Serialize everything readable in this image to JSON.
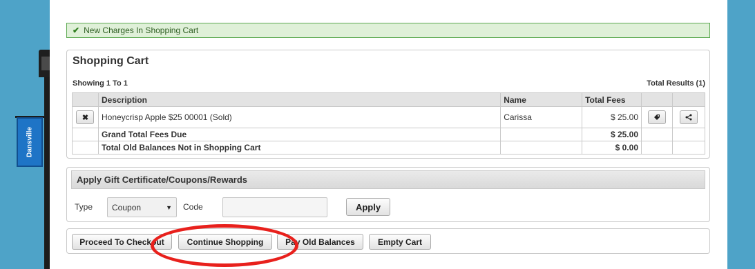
{
  "alert": {
    "text": "New Charges In Shopping Cart"
  },
  "cart": {
    "title": "Shopping Cart",
    "showing": "Showing 1 To 1",
    "total_results": "Total Results (1)",
    "columns": {
      "description": "Description",
      "name": "Name",
      "total_fees": "Total Fees"
    },
    "items": [
      {
        "description": "Honeycrisp Apple $25 00001 (Sold)",
        "name": "Carissa",
        "fee": "$ 25.00"
      }
    ],
    "grand_total_label": "Grand Total Fees Due",
    "grand_total_value": "$ 25.00",
    "old_balances_label": "Total Old Balances Not in Shopping Cart",
    "old_balances_value": "$ 0.00"
  },
  "gift": {
    "header": "Apply Gift Certificate/Coupons/Rewards",
    "type_label": "Type",
    "type_value": "Coupon",
    "code_label": "Code",
    "code_value": "",
    "apply_label": "Apply"
  },
  "actions": {
    "checkout": "Proceed To Checkout",
    "continue": "Continue Shopping",
    "old_balances": "Pay Old Balances",
    "empty": "Empty Cart"
  },
  "banner_text": "Dansville",
  "colors": {
    "background": "#4ea3c8",
    "alert_bg": "#dff0d8",
    "highlight_circle": "#e8201c"
  }
}
